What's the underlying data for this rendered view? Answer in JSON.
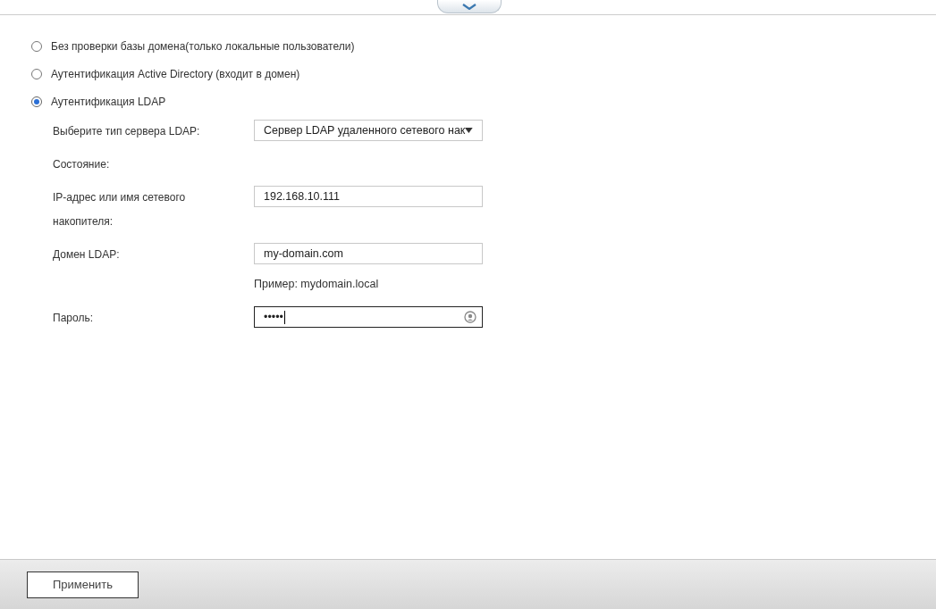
{
  "auth_options": [
    {
      "label": "Без проверки базы домена(только локальные пользователи)",
      "selected": false
    },
    {
      "label": "Аутентификация Active Directory (входит в домен)",
      "selected": false
    },
    {
      "label": "Аутентификация LDAP",
      "selected": true
    }
  ],
  "ldap_form": [
    {
      "kind": "select",
      "label": "Выберите тип сервера LDAP:",
      "value": "Сервер LDAP удаленного сетевого нак"
    },
    {
      "kind": "status",
      "label": "Состояние:"
    },
    {
      "kind": "input",
      "label": "IP-адрес или имя сетевого накопителя:",
      "value": "192.168.10.111"
    },
    {
      "kind": "input",
      "label": "Домен LDAP:",
      "value": "my-domain.com"
    },
    {
      "kind": "hint",
      "value": "Пример: mydomain.local"
    },
    {
      "kind": "password",
      "label": "Пароль:",
      "value": "•••••",
      "focused": true
    }
  ],
  "apply_button": "Применить"
}
